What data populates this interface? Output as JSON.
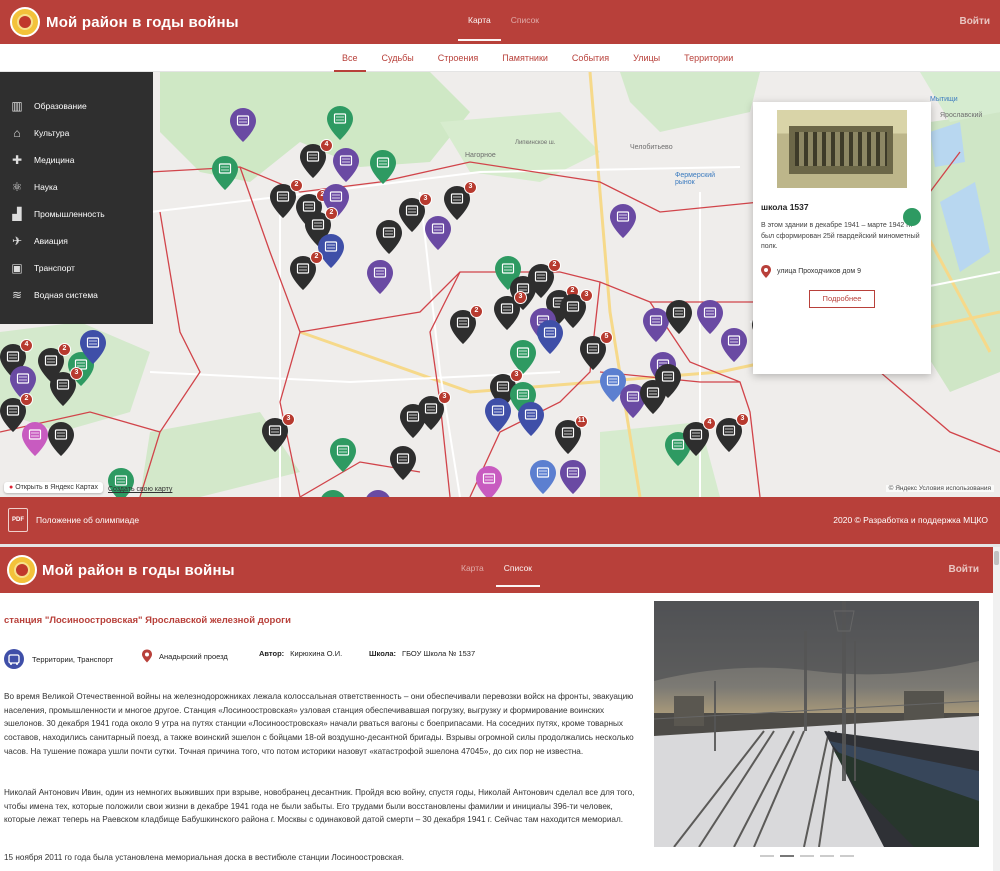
{
  "app": {
    "title": "Мой район в годы войны",
    "login": "Войти",
    "tabs": [
      {
        "label": "Карта"
      },
      {
        "label": "Список"
      }
    ]
  },
  "categories": [
    "Все",
    "Судьбы",
    "Строения",
    "Памятники",
    "События",
    "Улицы",
    "Территории"
  ],
  "sidebar": [
    {
      "label": "Образование",
      "icon": "school-icon"
    },
    {
      "label": "Культура",
      "icon": "museum-icon"
    },
    {
      "label": "Медицина",
      "icon": "medical-icon"
    },
    {
      "label": "Наука",
      "icon": "atom-icon"
    },
    {
      "label": "Промышленность",
      "icon": "factory-icon"
    },
    {
      "label": "Авиация",
      "icon": "plane-icon"
    },
    {
      "label": "Транспорт",
      "icon": "bus-icon"
    },
    {
      "label": "Водная система",
      "icon": "water-icon"
    }
  ],
  "map": {
    "labels": {
      "nagornoe": "Нагорное",
      "lipki": "Липкинское ш.",
      "chelobityevo": "Челобитьево",
      "farm": "Фермерский рынок",
      "mytishchi": "Мытищи",
      "yaroslavsky": "Ярославский"
    },
    "yandex_open": "Открыть в Яндекс Картах",
    "create_map": "Создать свою карту",
    "copyright": "© Яндекс Условия использования",
    "popup": {
      "title": "школа 1537",
      "description": "В этом здании в декабре 1941 – марте 1942 гг. был сформирован 25й гвардейский минометный полк.",
      "address": "улица Проходчиков дом 9",
      "more": "Подробнее"
    },
    "badges": [
      "4",
      "2",
      "2",
      "2",
      "3",
      "3",
      "2",
      "2",
      "2",
      "3",
      "2",
      "3",
      "5",
      "3",
      "3",
      "3",
      "3",
      "3",
      "4",
      "2",
      "3",
      "2",
      "11",
      "2",
      "4",
      "3",
      "3"
    ]
  },
  "footer": {
    "pdf": "PDF",
    "doc": "Положение об олимпиаде",
    "copyright": "2020 © Разработка и поддержка МЦКО"
  },
  "article": {
    "title": "станция \"Лосиноостровская\" Ярославской железной дороги",
    "category": "Территории, Транспорт",
    "location": "Анадырский проезд",
    "author_label": "Автор:",
    "author": "Кирюхина О.И.",
    "school_label": "Школа:",
    "school": "ГБОУ Школа № 1537",
    "paragraphs": [
      "Во время Великой Отечественной войны на железнодорожниках лежала колоссальная ответственность – они обеспечивали перевозки войск на фронты, эвакуацию населения, промышленности и многое другое. Станция «Лосиноостровская» узловая станция обеспечивавшая погрузку, выгрузку и формирование воинских эшелонов. 30 декабря 1941 года около 9 утра на путях станции «Лосиноостровская» начали рваться вагоны с боеприпасами. На соседних путях, кроме товарных составов, находились санитарный поезд, а также воинский эшелон с бойцами 18-ой воздушно-десантной бригады. Взрывы огромной силы продолжались несколько часов. На тушение пожара ушли почти сутки. Точная причина того, что потом историки назовут «катастрофой эшелона 47045», до сих пор не известна.",
      "Николай Антонович Ивин, один из немногих выживших при взрыве, новобранец десантник. Пройдя всю войну, спустя годы, Николай Антонович сделал все для того, чтобы имена тех, которые положили свои жизни в декабре 1941 года не были забыты. Его трудами были восстановлены фамилии и инициалы 396-ти человек, которые лежат теперь на Раевском кладбище Бабушкинского района г. Москвы с одинаковой датой смерти – 30 декабря 1941 г. Сейчас там находится мемориал.",
      "15 ноября 2011 го года была установлена мемориальная доска в вестибюле станции Лосиноостровская."
    ]
  },
  "colors": {
    "brand": "#b8403a",
    "pin_dark": "#2e2e2e",
    "pin_purple": "#6a4aa3",
    "pin_green": "#2e9a62",
    "pin_blue": "#3f4fa8",
    "pin_pink": "#c85bc0",
    "pin_lightblue": "#5c7fd0"
  }
}
